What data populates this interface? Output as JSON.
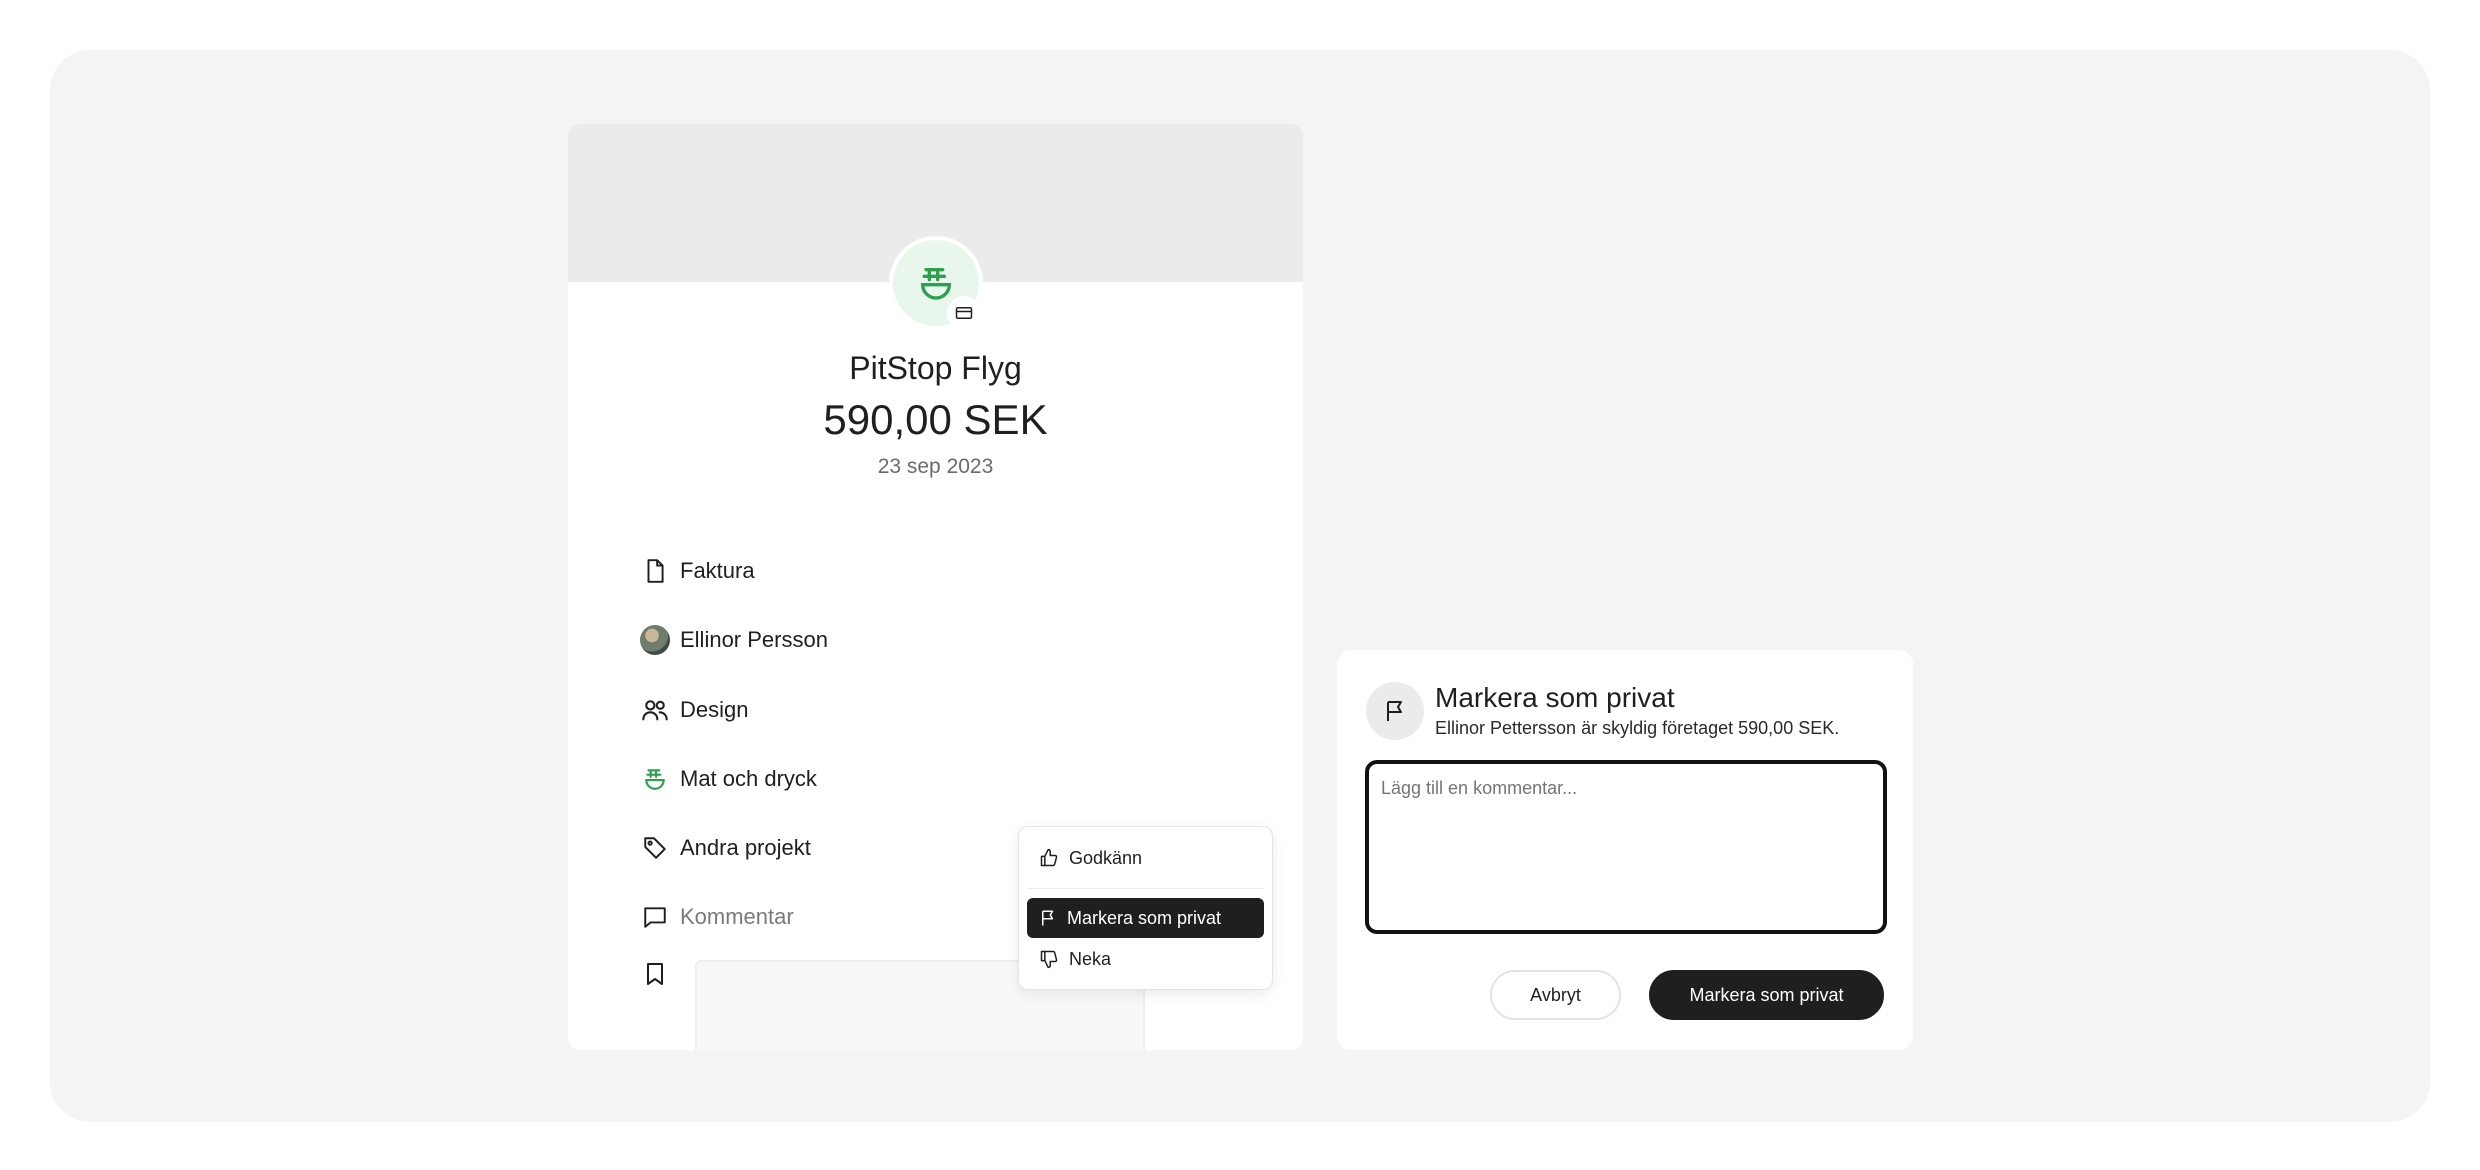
{
  "transaction": {
    "merchant": "PitStop Flyg",
    "amount": "590,00 SEK",
    "date": "23 sep 2023",
    "merchant_icon": "food-bowl-icon",
    "payment_icon": "card-icon",
    "accent_color": "#2e9e4f"
  },
  "details": [
    {
      "label": "Faktura",
      "icon": "document-icon"
    },
    {
      "label": "Ellinor Persson",
      "icon": "avatar"
    },
    {
      "label": "Design",
      "icon": "users-icon"
    },
    {
      "label": "Mat och dryck",
      "icon": "food-bowl-icon"
    },
    {
      "label": "Andra projekt",
      "icon": "tag-icon"
    },
    {
      "label": "Kommentar",
      "icon": "comment-icon"
    },
    {
      "label": "",
      "icon": "bookmark-icon"
    }
  ],
  "menu": {
    "items": [
      {
        "label": "Godkänn",
        "icon": "thumbs-up-icon"
      },
      {
        "label": "Markera som privat",
        "icon": "flag-icon",
        "selected": true
      },
      {
        "label": "Neka",
        "icon": "thumbs-down-icon"
      }
    ]
  },
  "panel": {
    "icon": "flag-icon",
    "title": "Markera som privat",
    "subtitle": "Ellinor Pettersson är skyldig företaget 590,00 SEK.",
    "comment_placeholder": "Lägg till en kommentar...",
    "comment_value": "",
    "cancel_label": "Avbryt",
    "confirm_label": "Markera som privat"
  }
}
